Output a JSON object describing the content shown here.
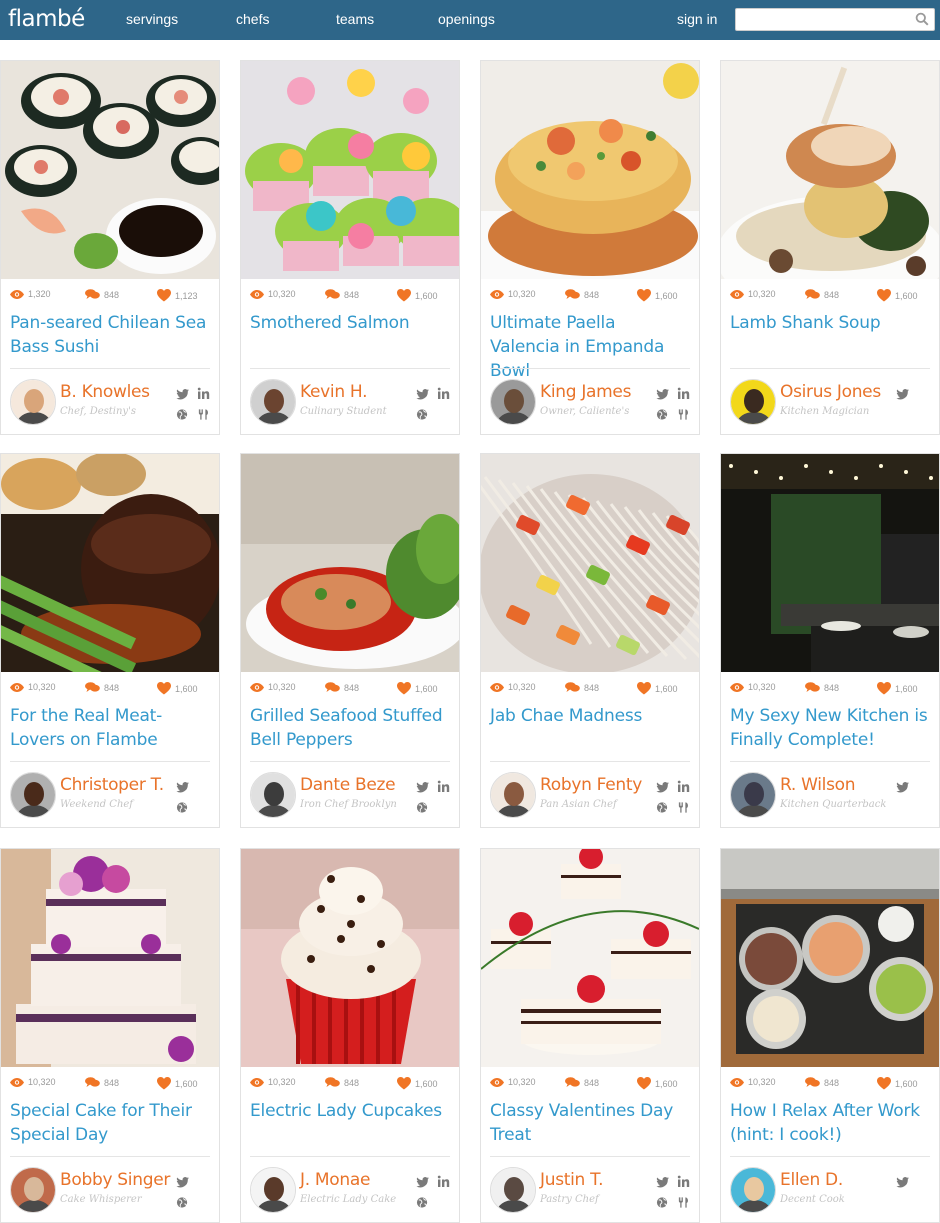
{
  "header": {
    "logo": "flambé",
    "nav": [
      "servings",
      "chefs",
      "teams",
      "openings"
    ],
    "signin": "sign in",
    "search_placeholder": ""
  },
  "colors": {
    "topbar": "#2e6689",
    "title": "#3399cc",
    "chef": "#e8732a",
    "heart": "#f07525"
  },
  "cards": [
    {
      "title": "Pan-seared Chilean Sea Bass Sushi",
      "views": "1,320",
      "comments": "848",
      "likes": "1,123",
      "chef": "B. Knowles",
      "role": "Chef, Destiny's",
      "socials": [
        "twitter",
        "linkedin",
        "globe",
        "fork"
      ],
      "photo": "sushi"
    },
    {
      "title": "Smothered Salmon",
      "views": "10,320",
      "comments": "848",
      "likes": "1,600",
      "chef": "Kevin H.",
      "role": "Culinary Student",
      "socials": [
        "twitter",
        "linkedin",
        "globe"
      ],
      "photo": "cupcakes"
    },
    {
      "title": "Ultimate Paella Valencia in Empanda Bowl",
      "views": "10,320",
      "comments": "848",
      "likes": "1,600",
      "chef": "King James",
      "role": "Owner, Caliente's",
      "socials": [
        "twitter",
        "linkedin",
        "globe",
        "fork"
      ],
      "photo": "paella"
    },
    {
      "title": "Lamb Shank Soup",
      "views": "10,320",
      "comments": "848",
      "likes": "1,600",
      "chef": "Osirus Jones",
      "role": "Kitchen Magician",
      "socials": [
        "twitter"
      ],
      "photo": "lamb"
    },
    {
      "title": "For the Real Meat-Lovers on Flambe",
      "views": "10,320",
      "comments": "848",
      "likes": "1,600",
      "chef": "Christoper T.",
      "role": "Weekend Chef",
      "socials": [
        "twitter",
        "globe"
      ],
      "photo": "steak"
    },
    {
      "title": "Grilled Seafood Stuffed Bell Peppers",
      "views": "10,320",
      "comments": "848",
      "likes": "1,600",
      "chef": "Dante Beze",
      "role": "Iron Chef Brooklyn",
      "socials": [
        "twitter",
        "linkedin",
        "globe"
      ],
      "photo": "pepper"
    },
    {
      "title": "Jab Chae Madness",
      "views": "10,320",
      "comments": "848",
      "likes": "1,600",
      "chef": "Robyn Fenty",
      "role": "Pan Asian Chef",
      "socials": [
        "twitter",
        "linkedin",
        "globe",
        "fork"
      ],
      "photo": "noodles"
    },
    {
      "title": "My Sexy New Kitchen is Finally Complete!",
      "views": "10,320",
      "comments": "848",
      "likes": "1,600",
      "chef": "R. Wilson",
      "role": "Kitchen Quarterback",
      "socials": [
        "twitter"
      ],
      "photo": "kitchen"
    },
    {
      "title": "Special Cake for Their Special Day",
      "views": "10,320",
      "comments": "848",
      "likes": "1,600",
      "chef": "Bobby Singer",
      "role": "Cake Whisperer",
      "socials": [
        "twitter",
        "globe"
      ],
      "photo": "weddingcake"
    },
    {
      "title": "Electric Lady Cupcakes",
      "views": "10,320",
      "comments": "848",
      "likes": "1,600",
      "chef": "J. Monae",
      "role": "Electric Lady Cake",
      "socials": [
        "twitter",
        "linkedin",
        "globe"
      ],
      "photo": "cupcake"
    },
    {
      "title": "Classy Valentines Day Treat",
      "views": "10,320",
      "comments": "848",
      "likes": "1,600",
      "chef": "Justin T.",
      "role": "Pastry Chef",
      "socials": [
        "twitter",
        "linkedin",
        "globe",
        "fork"
      ],
      "photo": "valentine"
    },
    {
      "title": "How I Relax After Work (hint: I cook!)",
      "views": "10,320",
      "comments": "848",
      "likes": "1,600",
      "chef": "Ellen D.",
      "role": "Decent Cook",
      "socials": [
        "twitter"
      ],
      "photo": "stove"
    }
  ]
}
